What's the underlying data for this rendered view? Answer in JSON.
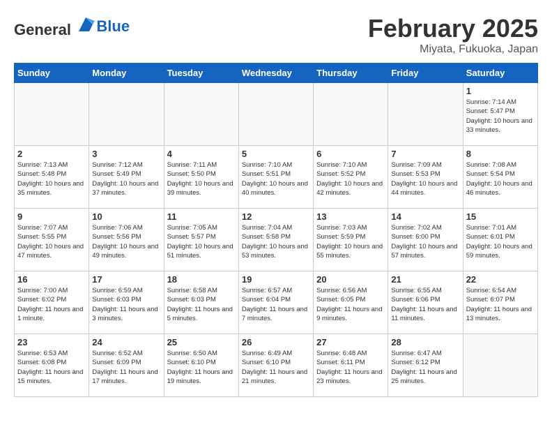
{
  "header": {
    "logo_general": "General",
    "logo_blue": "Blue",
    "month_year": "February 2025",
    "location": "Miyata, Fukuoka, Japan"
  },
  "days_of_week": [
    "Sunday",
    "Monday",
    "Tuesday",
    "Wednesday",
    "Thursday",
    "Friday",
    "Saturday"
  ],
  "weeks": [
    [
      {
        "day": "",
        "info": ""
      },
      {
        "day": "",
        "info": ""
      },
      {
        "day": "",
        "info": ""
      },
      {
        "day": "",
        "info": ""
      },
      {
        "day": "",
        "info": ""
      },
      {
        "day": "",
        "info": ""
      },
      {
        "day": "1",
        "info": "Sunrise: 7:14 AM\nSunset: 5:47 PM\nDaylight: 10 hours and 33 minutes."
      }
    ],
    [
      {
        "day": "2",
        "info": "Sunrise: 7:13 AM\nSunset: 5:48 PM\nDaylight: 10 hours and 35 minutes."
      },
      {
        "day": "3",
        "info": "Sunrise: 7:12 AM\nSunset: 5:49 PM\nDaylight: 10 hours and 37 minutes."
      },
      {
        "day": "4",
        "info": "Sunrise: 7:11 AM\nSunset: 5:50 PM\nDaylight: 10 hours and 39 minutes."
      },
      {
        "day": "5",
        "info": "Sunrise: 7:10 AM\nSunset: 5:51 PM\nDaylight: 10 hours and 40 minutes."
      },
      {
        "day": "6",
        "info": "Sunrise: 7:10 AM\nSunset: 5:52 PM\nDaylight: 10 hours and 42 minutes."
      },
      {
        "day": "7",
        "info": "Sunrise: 7:09 AM\nSunset: 5:53 PM\nDaylight: 10 hours and 44 minutes."
      },
      {
        "day": "8",
        "info": "Sunrise: 7:08 AM\nSunset: 5:54 PM\nDaylight: 10 hours and 46 minutes."
      }
    ],
    [
      {
        "day": "9",
        "info": "Sunrise: 7:07 AM\nSunset: 5:55 PM\nDaylight: 10 hours and 47 minutes."
      },
      {
        "day": "10",
        "info": "Sunrise: 7:06 AM\nSunset: 5:56 PM\nDaylight: 10 hours and 49 minutes."
      },
      {
        "day": "11",
        "info": "Sunrise: 7:05 AM\nSunset: 5:57 PM\nDaylight: 10 hours and 51 minutes."
      },
      {
        "day": "12",
        "info": "Sunrise: 7:04 AM\nSunset: 5:58 PM\nDaylight: 10 hours and 53 minutes."
      },
      {
        "day": "13",
        "info": "Sunrise: 7:03 AM\nSunset: 5:59 PM\nDaylight: 10 hours and 55 minutes."
      },
      {
        "day": "14",
        "info": "Sunrise: 7:02 AM\nSunset: 6:00 PM\nDaylight: 10 hours and 57 minutes."
      },
      {
        "day": "15",
        "info": "Sunrise: 7:01 AM\nSunset: 6:01 PM\nDaylight: 10 hours and 59 minutes."
      }
    ],
    [
      {
        "day": "16",
        "info": "Sunrise: 7:00 AM\nSunset: 6:02 PM\nDaylight: 11 hours and 1 minute."
      },
      {
        "day": "17",
        "info": "Sunrise: 6:59 AM\nSunset: 6:03 PM\nDaylight: 11 hours and 3 minutes."
      },
      {
        "day": "18",
        "info": "Sunrise: 6:58 AM\nSunset: 6:03 PM\nDaylight: 11 hours and 5 minutes."
      },
      {
        "day": "19",
        "info": "Sunrise: 6:57 AM\nSunset: 6:04 PM\nDaylight: 11 hours and 7 minutes."
      },
      {
        "day": "20",
        "info": "Sunrise: 6:56 AM\nSunset: 6:05 PM\nDaylight: 11 hours and 9 minutes."
      },
      {
        "day": "21",
        "info": "Sunrise: 6:55 AM\nSunset: 6:06 PM\nDaylight: 11 hours and 11 minutes."
      },
      {
        "day": "22",
        "info": "Sunrise: 6:54 AM\nSunset: 6:07 PM\nDaylight: 11 hours and 13 minutes."
      }
    ],
    [
      {
        "day": "23",
        "info": "Sunrise: 6:53 AM\nSunset: 6:08 PM\nDaylight: 11 hours and 15 minutes."
      },
      {
        "day": "24",
        "info": "Sunrise: 6:52 AM\nSunset: 6:09 PM\nDaylight: 11 hours and 17 minutes."
      },
      {
        "day": "25",
        "info": "Sunrise: 6:50 AM\nSunset: 6:10 PM\nDaylight: 11 hours and 19 minutes."
      },
      {
        "day": "26",
        "info": "Sunrise: 6:49 AM\nSunset: 6:10 PM\nDaylight: 11 hours and 21 minutes."
      },
      {
        "day": "27",
        "info": "Sunrise: 6:48 AM\nSunset: 6:11 PM\nDaylight: 11 hours and 23 minutes."
      },
      {
        "day": "28",
        "info": "Sunrise: 6:47 AM\nSunset: 6:12 PM\nDaylight: 11 hours and 25 minutes."
      },
      {
        "day": "",
        "info": ""
      }
    ]
  ]
}
